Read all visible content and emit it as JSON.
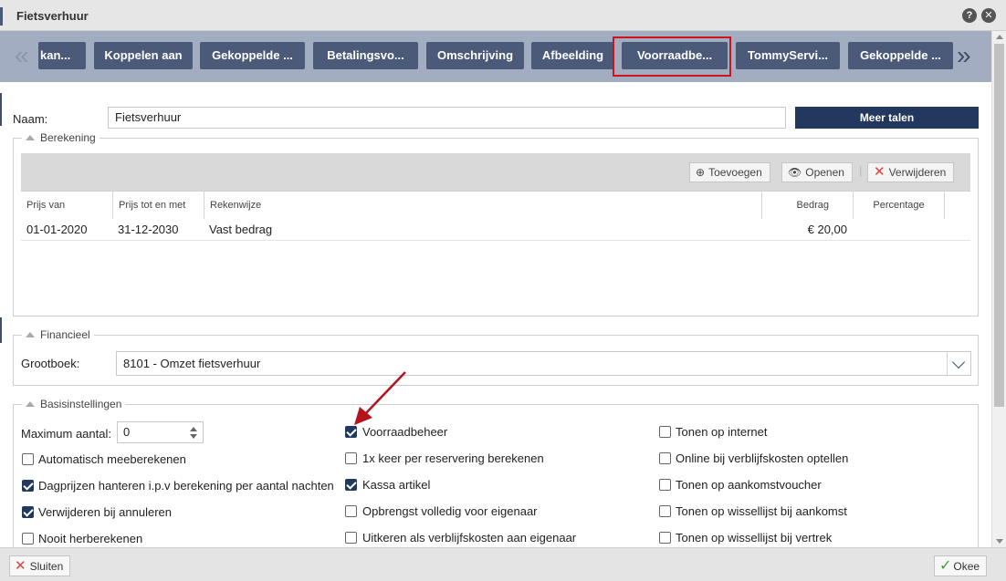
{
  "window": {
    "title": "Fietsverhuur"
  },
  "tabs": [
    {
      "label": "kan..."
    },
    {
      "label": "Koppelen aan"
    },
    {
      "label": "Gekoppelde ..."
    },
    {
      "label": "Betalingsvo..."
    },
    {
      "label": "Omschrijving"
    },
    {
      "label": "Afbeelding"
    },
    {
      "label": "Voorraadbe..."
    },
    {
      "label": "TommyServi..."
    },
    {
      "label": "Gekoppelde ..."
    }
  ],
  "naam": {
    "label": "Naam:",
    "value": "Fietsverhuur",
    "more_languages": "Meer talen"
  },
  "berekening": {
    "legend": "Berekening",
    "toolbar": {
      "add": "Toevoegen",
      "open": "Openen",
      "delete": "Verwijderen"
    },
    "columns": [
      "Prijs van",
      "Prijs tot en met",
      "Rekenwijze",
      "Bedrag",
      "Percentage"
    ],
    "rows": [
      {
        "from": "01-01-2020",
        "to": "31-12-2030",
        "method": "Vast bedrag",
        "amount": "€ 20,00",
        "percentage": ""
      }
    ]
  },
  "financieel": {
    "legend": "Financieel",
    "grootboek_label": "Grootboek:",
    "grootboek_value": "8101 - Omzet fietsverhuur"
  },
  "basis": {
    "legend": "Basisinstellingen",
    "max_label": "Maximum aantal:",
    "max_value": "0",
    "col1": [
      {
        "label": "Automatisch meeberekenen",
        "checked": false
      },
      {
        "label": "Dagprijzen hanteren i.p.v berekening per aantal nachten",
        "checked": true
      },
      {
        "label": "Verwijderen bij annuleren",
        "checked": true
      },
      {
        "label": "Nooit herberekenen",
        "checked": false
      }
    ],
    "col2": [
      {
        "label": "Voorraadbeheer",
        "checked": true
      },
      {
        "label": "1x keer per reservering berekenen",
        "checked": false
      },
      {
        "label": "Kassa artikel",
        "checked": true
      },
      {
        "label": "Opbrengst volledig voor eigenaar",
        "checked": false
      },
      {
        "label": "Uitkeren als verblijfskosten aan eigenaar",
        "checked": false
      }
    ],
    "col3": [
      {
        "label": "Tonen op internet",
        "checked": false
      },
      {
        "label": "Online bij verblijfskosten optellen",
        "checked": false
      },
      {
        "label": "Tonen op aankomstvoucher",
        "checked": false
      },
      {
        "label": "Tonen op wissellijst bij aankomst",
        "checked": false
      },
      {
        "label": "Tonen op wissellijst bij vertrek",
        "checked": false
      }
    ]
  },
  "footer": {
    "close": "Sluiten",
    "ok": "Okee"
  },
  "colors": {
    "accent": "#22385e",
    "tab": "#4a5a78",
    "highlight": "#d0141a",
    "annotation_arrow": "#b5121b"
  },
  "icons": [
    "help-icon",
    "close-icon",
    "plus-circle-icon",
    "eye-icon",
    "x-icon",
    "check-icon",
    "chevron-down-icon",
    "double-chevron-left-icon",
    "double-chevron-right-icon"
  ]
}
